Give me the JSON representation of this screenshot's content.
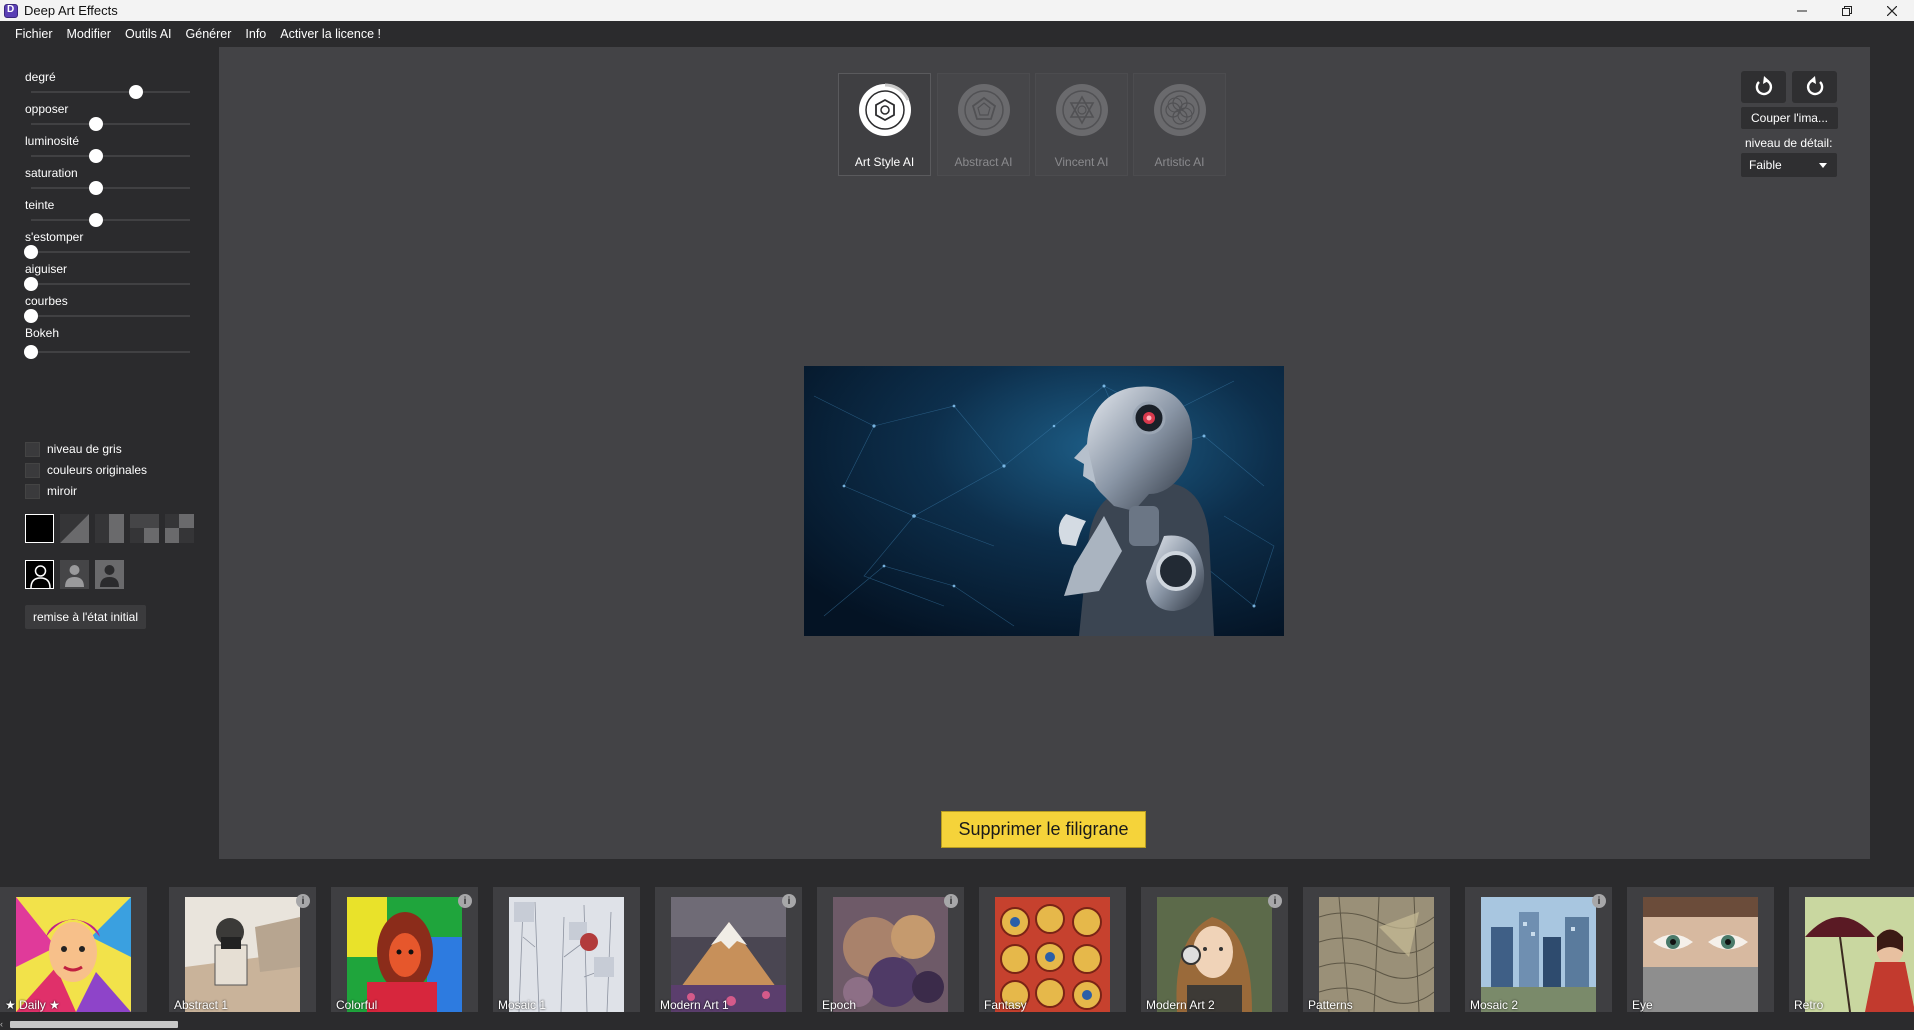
{
  "window": {
    "title": "Deep Art Effects"
  },
  "menu": [
    "Fichier",
    "Modifier",
    "Outils AI",
    "Générer",
    "Info",
    "Activer la licence !"
  ],
  "sliders": [
    {
      "label": "degré",
      "value": 0.66
    },
    {
      "label": "opposer",
      "value": 0.41
    },
    {
      "label": "luminosité",
      "value": 0.41
    },
    {
      "label": "saturation",
      "value": 0.41
    },
    {
      "label": "teinte",
      "value": 0.41
    },
    {
      "label": "s'estomper",
      "value": 0.0
    },
    {
      "label": "aiguiser",
      "value": 0.0
    },
    {
      "label": "courbes",
      "value": 0.0
    },
    {
      "label": "Bokeh",
      "value": 0.0
    }
  ],
  "checkboxes": [
    {
      "label": "niveau de gris",
      "checked": false
    },
    {
      "label": "couleurs originales",
      "checked": false
    },
    {
      "label": "miroir",
      "checked": false
    }
  ],
  "reset_label": "remise à l'état initial",
  "ai_tabs": [
    {
      "label": "Art Style AI",
      "active": true
    },
    {
      "label": "Abstract AI",
      "active": false
    },
    {
      "label": "Vincent AI",
      "active": false
    },
    {
      "label": "Artistic AI",
      "active": false
    }
  ],
  "right_panel": {
    "undo_icon": "undo-icon",
    "redo_icon": "redo-icon",
    "crop_label": "Couper l'ima...",
    "detail_label": "niveau de détail:",
    "detail_value": "Faible"
  },
  "watermark_label": "Supprimer le filigrane",
  "styles": [
    {
      "label": "★ Daily ★",
      "info": false
    },
    {
      "label": "Abstract 1",
      "info": true
    },
    {
      "label": "Colorful",
      "info": true
    },
    {
      "label": "Mosaic 1",
      "info": false
    },
    {
      "label": "Modern Art 1",
      "info": true
    },
    {
      "label": "Epoch",
      "info": true
    },
    {
      "label": "Fantasy",
      "info": false
    },
    {
      "label": "Modern Art 2",
      "info": true
    },
    {
      "label": "Patterns",
      "info": false
    },
    {
      "label": "Mosaic 2",
      "info": true
    },
    {
      "label": "Eye",
      "info": false
    },
    {
      "label": "Retro",
      "info": false
    }
  ],
  "info_glyph": "i",
  "colors": {
    "accent": "#f5d33a",
    "canvas": "#434346",
    "panel": "#2b2b2d"
  }
}
